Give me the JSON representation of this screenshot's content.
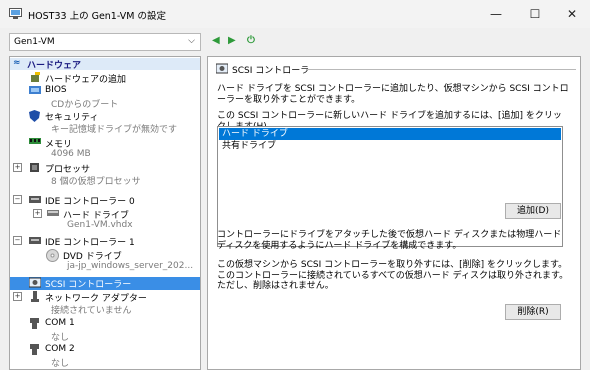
{
  "window": {
    "title": "HOST33 上の Gen1-VM の設定",
    "minimize": "—",
    "maximize": "☐",
    "close": "✕"
  },
  "vm_selector": {
    "value": "Gen1-VM"
  },
  "nav": {
    "back": "◀",
    "forward": "▶",
    "power": "⏻"
  },
  "tree": {
    "hardware_header": "ハードウェア",
    "items": [
      {
        "label": "ハードウェアの追加"
      },
      {
        "label": "BIOS",
        "sub": "CDからのブート"
      },
      {
        "label": "セキュリティ",
        "sub": "キー記憶域ドライブが無効です"
      },
      {
        "label": "メモリ",
        "sub": "4096 MB"
      },
      {
        "label": "プロセッサ",
        "sub": "8 個の仮想プロセッサ"
      },
      {
        "label": "IDE コントローラー 0"
      },
      {
        "label": "ハード ドライブ",
        "sub": "Gen1-VM.vhdx"
      },
      {
        "label": "IDE コントローラー 1"
      },
      {
        "label": "DVD ドライブ",
        "sub": "ja-jp_windows_server_202..."
      },
      {
        "label": "SCSI コントローラー"
      },
      {
        "label": "ネットワーク アダプター",
        "sub": "接続されていません"
      },
      {
        "label": "COM 1",
        "sub": "なし"
      },
      {
        "label": "COM 2",
        "sub": "なし"
      }
    ]
  },
  "panel": {
    "section_title": "SCSI コントローラー",
    "desc1": "ハード ドライブを SCSI コントローラーに追加したり、仮想マシンから SCSI コントローラーを取り外すことができます。",
    "desc2": "この SCSI コントローラーに新しいハード ドライブを追加するには、[追加] をクリックします(H)。",
    "list": [
      "ハード ドライブ",
      "共有ドライブ"
    ],
    "add_button": "追加(D)",
    "desc3": "コントローラーにドライブをアタッチした後で仮想ハード ディスクまたは物理ハード ディスクを使用するようにハード ドライブを構成できます。",
    "desc4": "この仮想マシンから SCSI コントローラーを取り外すには、[削除] をクリックします。このコントローラーに接続されているすべての仮想ハード ディスクは取り外されます。ただし、削除はされません。",
    "delete_button": "削除(R)"
  }
}
